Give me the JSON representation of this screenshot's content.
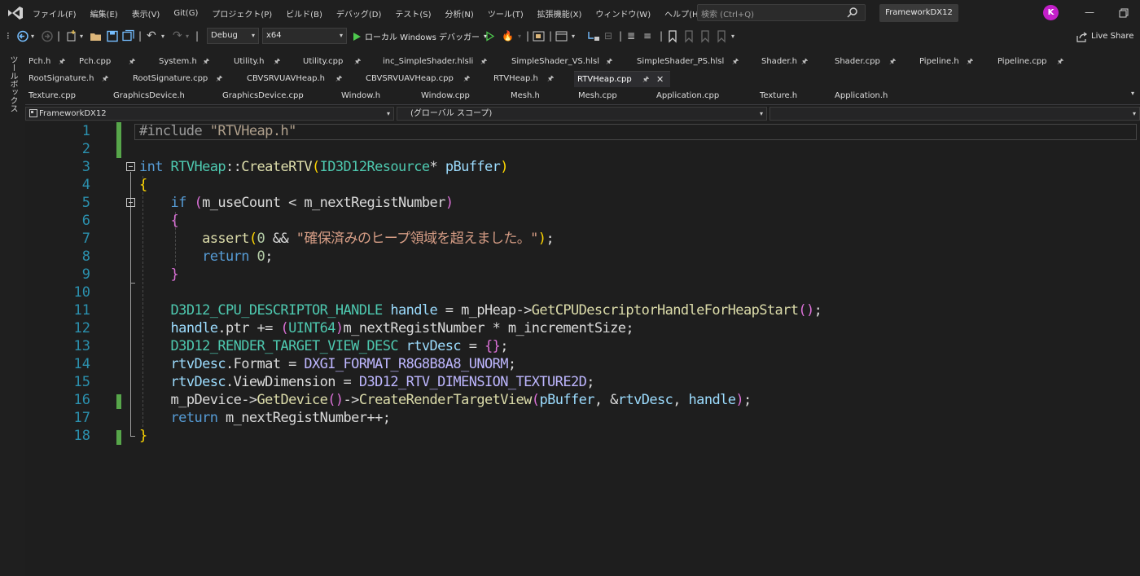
{
  "menubar": {
    "items": [
      "ファイル(F)",
      "編集(E)",
      "表示(V)",
      "Git(G)",
      "プロジェクト(P)",
      "ビルド(B)",
      "デバッグ(D)",
      "テスト(S)",
      "分析(N)",
      "ツール(T)",
      "拡張機能(X)",
      "ウィンドウ(W)",
      "ヘルプ(H)"
    ],
    "search_placeholder": "検索 (Ctrl+Q)",
    "solution_name": "FrameworkDX12",
    "avatar_initial": "K",
    "accent_color": "#c31fc9"
  },
  "toolbar": {
    "configuration": "Debug",
    "platform": "x64",
    "start_debug_label": "ローカル Windows デバッガー",
    "live_share_label": "Live Share"
  },
  "side_strip": {
    "toolbox_label": "ツールボックス"
  },
  "tabs": {
    "row1": [
      "Pch.h",
      "Pch.cpp",
      "System.h",
      "Utility.h",
      "Utility.cpp",
      "inc_SimpleShader.hlsli",
      "SimpleShader_VS.hlsl",
      "SimpleShader_PS.hlsl",
      "Shader.h",
      "Shader.cpp",
      "Pipeline.h",
      "Pipeline.cpp"
    ],
    "row2": [
      "RootSignature.h",
      "RootSignature.cpp",
      "CBVSRVUAVHeap.h",
      "CBVSRVUAVHeap.cpp",
      "RTVHeap.h",
      "RTVHeap.cpp"
    ],
    "row3": [
      "Texture.cpp",
      "GraphicsDevice.h",
      "GraphicsDevice.cpp",
      "Window.h",
      "Window.cpp",
      "Mesh.h",
      "Mesh.cpp",
      "Application.cpp",
      "Texture.h",
      "Application.h"
    ],
    "active_tab": "RTVHeap.cpp"
  },
  "navbar": {
    "project": "FrameworkDX12",
    "scope": "(グローバル スコープ)",
    "member": ""
  },
  "editor": {
    "line_numbers": [
      "1",
      "2",
      "3",
      "4",
      "5",
      "6",
      "7",
      "8",
      "9",
      "10",
      "11",
      "12",
      "13",
      "14",
      "15",
      "16",
      "17",
      "18"
    ],
    "lines": {
      "l1_include": "#include",
      "l1_file": "\"RTVHeap.h\"",
      "l3_int": "int",
      "l3_class": "RTVHeap",
      "l3_scope": "::",
      "l3_func": "CreateRTV",
      "l3_open": "(",
      "l3_type": "ID3D12Resource",
      "l3_ptr": "* ",
      "l3_param": "pBuffer",
      "l3_close": ")",
      "l4_brace": "{",
      "l5_if": "if",
      "l5_open": "(",
      "l5_a": "m_useCount",
      "l5_lt": " < ",
      "l5_b": "m_nextRegistNumber",
      "l5_close": ")",
      "l6_brace": "{",
      "l7_assert": "assert",
      "l7_open": "(",
      "l7_zero": "0",
      "l7_and": " && ",
      "l7_msg": "\"確保済みのヒープ領域を超えました。\"",
      "l7_close": ")",
      "l7_semi": ";",
      "l8_return": "return",
      "l8_zero": " 0",
      "l8_semi": ";",
      "l9_brace": "}",
      "l11_type": "D3D12_CPU_DESCRIPTOR_HANDLE",
      "l11_var": " handle",
      "l11_eq": " = ",
      "l11_heap": "m_pHeap",
      "l11_arrow": "->",
      "l11_fn": "GetCPUDescriptorHandleForHeapStart",
      "l11_parens": "()",
      "l11_semi": ";",
      "l12_handle": "handle",
      "l12_dot": ".",
      "l12_ptr": "ptr",
      "l12_op": " += ",
      "l12_open": "(",
      "l12_cast": "UINT64",
      "l12_close": ")",
      "l12_next": "m_nextRegistNumber",
      "l12_mul": " * ",
      "l12_inc": "m_incrementSize",
      "l12_semi": ";",
      "l13_type": "D3D12_RENDER_TARGET_VIEW_DESC",
      "l13_var": " rtvDesc",
      "l13_eq": " = ",
      "l13_init": "{}",
      "l13_semi": ";",
      "l14_var": "rtvDesc",
      "l14_dot": ".",
      "l14_field": "Format",
      "l14_eq": " = ",
      "l14_val": "DXGI_FORMAT_R8G8B8A8_UNORM",
      "l14_semi": ";",
      "l15_var": "rtvDesc",
      "l15_dot": ".",
      "l15_field": "ViewDimension",
      "l15_eq": " = ",
      "l15_val": "D3D12_RTV_DIMENSION_TEXTURE2D",
      "l15_semi": ";",
      "l16_dev": "m_pDevice",
      "l16_arrow": "->",
      "l16_fn": "GetDevice",
      "l16_parens": "()",
      "l16_arrow2": "->",
      "l16_fn2": "CreateRenderTargetView",
      "l16_open": "(",
      "l16_a1": "pBuffer",
      "l16_c1": ", ",
      "l16_amp": "&",
      "l16_a2": "rtvDesc",
      "l16_c2": ", ",
      "l16_a3": "handle",
      "l16_close": ")",
      "l16_semi": ";",
      "l17_return": "return",
      "l17_var": " m_nextRegistNumber",
      "l17_inc": "++",
      "l17_semi": ";",
      "l18_brace": "}"
    }
  }
}
